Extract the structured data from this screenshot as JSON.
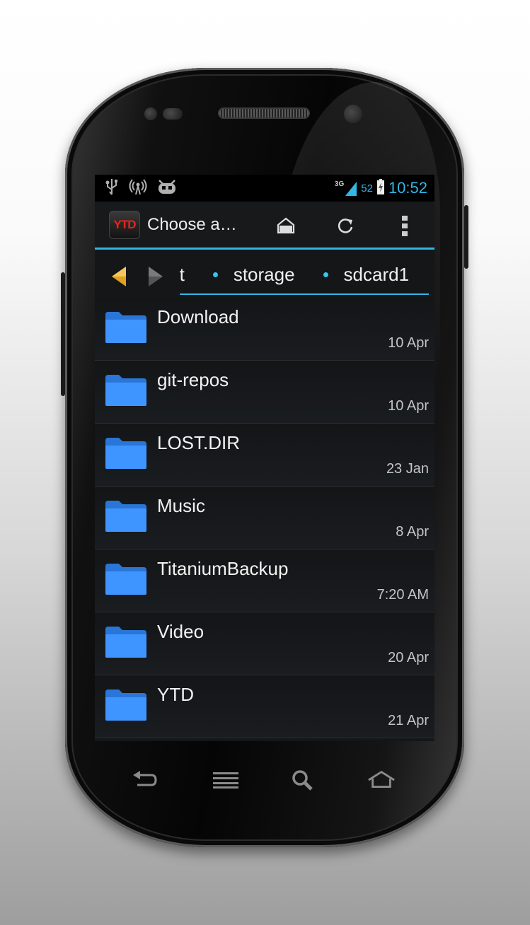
{
  "status_bar": {
    "left_icons": [
      "usb-icon",
      "wireless-tether-icon",
      "android-debug-icon"
    ],
    "network": "3G",
    "battery": "52",
    "time": "10:52"
  },
  "action_bar": {
    "app_logo_text": "YTD",
    "title": "Choose a…",
    "actions": [
      "home-icon",
      "refresh-icon",
      "overflow-menu-icon"
    ]
  },
  "breadcrumb": {
    "segments": [
      "root",
      "storage",
      "sdcard1"
    ]
  },
  "files": [
    {
      "name": "Download",
      "date": "10 Apr"
    },
    {
      "name": "git-repos",
      "date": "10 Apr"
    },
    {
      "name": "LOST.DIR",
      "date": "23 Jan"
    },
    {
      "name": "Music",
      "date": "8 Apr"
    },
    {
      "name": "TitaniumBackup",
      "date": "7:20 AM"
    },
    {
      "name": "Video",
      "date": "20 Apr"
    },
    {
      "name": "YTD",
      "date": "21 Apr"
    }
  ],
  "nav_bar": [
    "back-icon",
    "menu-icon",
    "search-icon",
    "home-icon"
  ],
  "colors": {
    "accent": "#33b5e5",
    "folder": "#3d8cf5",
    "logo_red": "#e8231c"
  }
}
